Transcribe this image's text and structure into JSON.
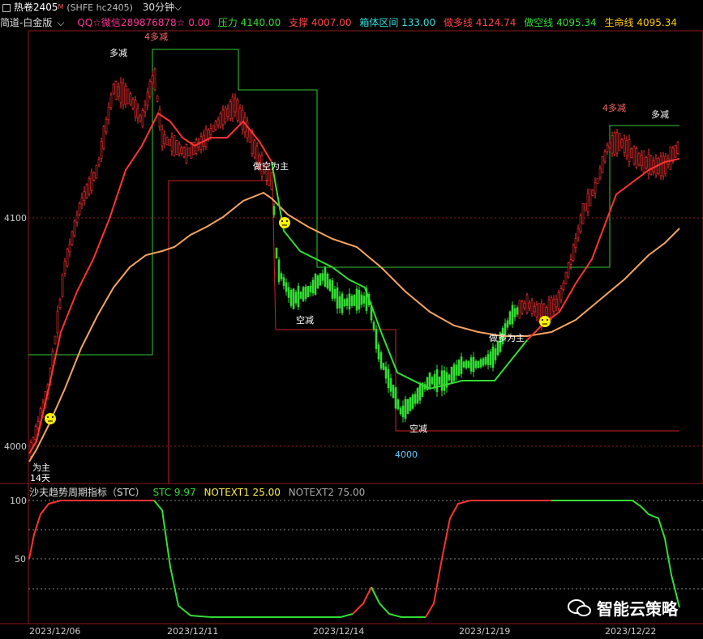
{
  "header": {
    "symbol": "热卷2405",
    "sup": "M",
    "code": "(SHFE hc2405)",
    "period": "30分钟"
  },
  "indicator_bar": {
    "name": "简道-白金版",
    "qq": "QQ☆微信289876878☆ 0.00",
    "pressure": "压力 4140.00",
    "support": "支撑 4007.00",
    "box_range": "箱体区间 133.00",
    "long_line": "做多线 4124.74",
    "short_line": "做空线 4095.34",
    "life_line": "生命线 4095.34"
  },
  "main_axis": {
    "label_4100": "4100",
    "label_4000": "4000"
  },
  "annotations": {
    "a1": "4多减",
    "a2": "多减",
    "a3": "做空为主",
    "a4": "空减",
    "a5": "空减",
    "a6": "做多为主",
    "a7": "4多减",
    "a8": "多减",
    "a9": "为主",
    "a10": "14天",
    "low_label": "4000"
  },
  "stc_legend": {
    "name": "沙夫趋势周期指标（STC）",
    "stc": "STC 9.97",
    "n1": "NOTEXT1 25.00",
    "n2": "NOTEXT2 75.00"
  },
  "stc_axis": {
    "l100": "100",
    "l50": "50"
  },
  "dates": {
    "d1": "2023/12/06",
    "d2": "2023/12/11",
    "d3": "2023/12/14",
    "d4": "2023/12/19",
    "d5": "2023/12/22"
  },
  "watermark": {
    "text": "智能云策略"
  },
  "colors": {
    "bull": "#ff3333",
    "bear": "#33dd33",
    "life": "#f4a460",
    "box": "#33cc33"
  }
}
